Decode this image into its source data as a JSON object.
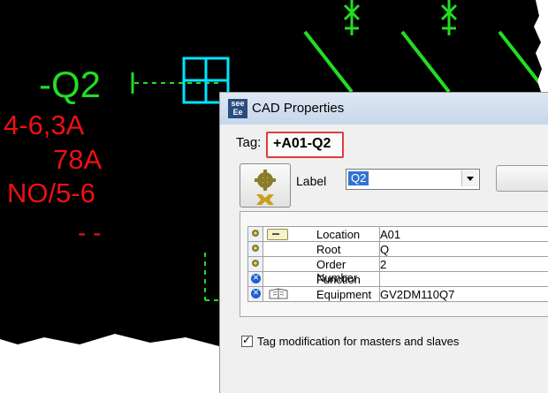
{
  "cad": {
    "reference": "-Q2",
    "specs": [
      "4-6,3A",
      "78A",
      "NO/5-6",
      "- -"
    ],
    "colors": {
      "background": "#000000",
      "green": "#22dd22",
      "cyan": "#00e5ff",
      "red": "#ee1111"
    }
  },
  "dialog": {
    "app_icon_text": [
      "see",
      "Ee"
    ],
    "title": "CAD Properties",
    "tag_label": "Tag:",
    "tag_value": "+A01-Q2",
    "label_caption": "Label",
    "label_value": "Q2",
    "properties": [
      {
        "icon": "gear-icon",
        "extra_icon": "folder-icon",
        "name": "Location",
        "value": "A01"
      },
      {
        "icon": "gear-icon",
        "extra_icon": "",
        "name": "Root",
        "value": "Q"
      },
      {
        "icon": "gear-icon",
        "extra_icon": "",
        "name": "Order Number",
        "value": "2"
      },
      {
        "icon": "function-icon",
        "extra_icon": "",
        "name": "Function",
        "value": ""
      },
      {
        "icon": "function-icon",
        "extra_icon": "book-icon",
        "name": "Equipment",
        "value": "GV2DM110Q7"
      }
    ],
    "tag_modification_label": "Tag modification for masters and slaves",
    "tag_modification_checked": true,
    "highlight_color": "#e23b3b",
    "selection_color": "#3174d0"
  }
}
